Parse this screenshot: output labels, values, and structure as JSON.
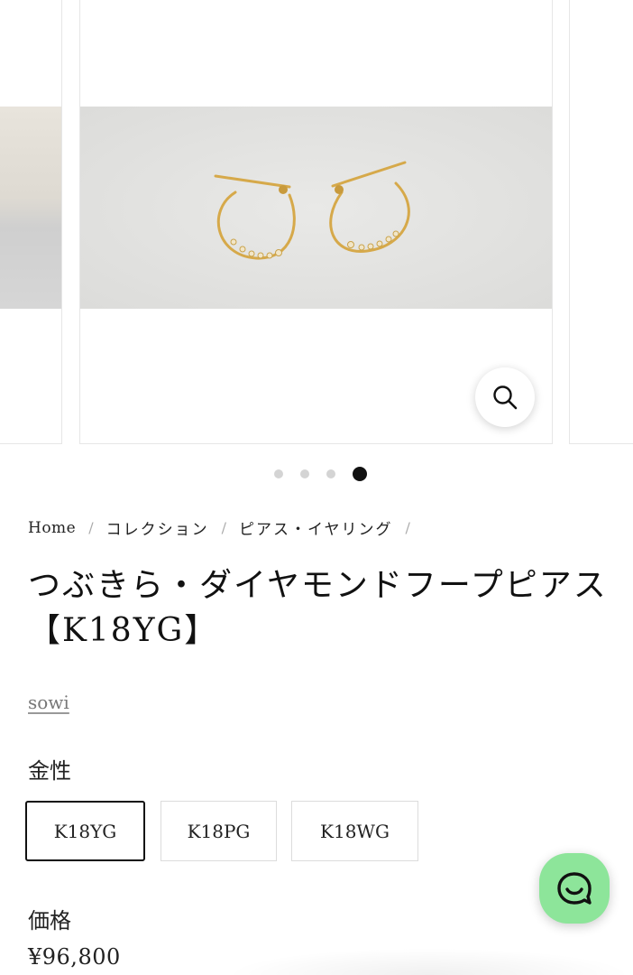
{
  "product": {
    "breadcrumb": [
      {
        "label": "Home"
      },
      {
        "label": "コレクション"
      },
      {
        "label": "ピアス・イヤリング"
      }
    ],
    "breadcrumb_separator": "/",
    "title": "つぶきら・ダイヤモンドフープピアス【K18YG】",
    "vendor": "sowi",
    "option_label": "金性",
    "options": [
      "K18YG",
      "K18PG",
      "K18WG"
    ],
    "selected_option": "K18YG",
    "price_label": "価格",
    "price": "¥96,800"
  },
  "carousel": {
    "slide_count": 4,
    "active_index": 3
  },
  "icons": {
    "zoom": "magnifier-icon",
    "chat": "chat-bubble-icon"
  },
  "colors": {
    "chat_button": "#8de59a",
    "selected_border": "#111111",
    "active_dot": "#111111",
    "inactive_dot": "#d4d4d4"
  }
}
